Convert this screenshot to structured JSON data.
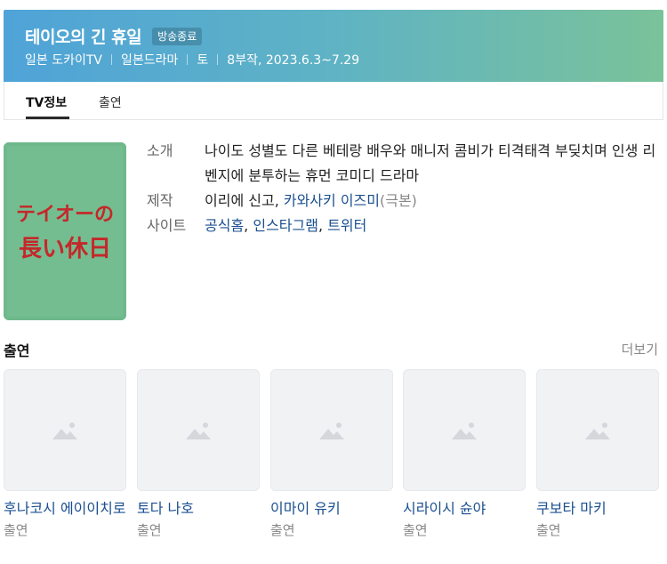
{
  "header": {
    "title": "테이오의 긴 휴일",
    "badge": "방송종료",
    "meta": [
      "일본 도카이TV",
      "일본드라마",
      "토",
      "8부작, 2023.6.3~7.29"
    ],
    "gradient_colors": [
      "#4fa3d8",
      "#7ac29a"
    ]
  },
  "tabs": [
    {
      "label": "TV정보",
      "active": true
    },
    {
      "label": "출연",
      "active": false
    }
  ],
  "poster": {
    "icon": "poster-image",
    "title_lines": [
      "テイオーの",
      "長い休日"
    ],
    "bg_color": "#6fb88c",
    "text_color": "#c4282a"
  },
  "info": {
    "intro_label": "소개",
    "intro_text": "나이도 성별도 다른 베테랑 배우와 매니저 콤비가 티격태격 부딪치며 인생 리벤지에 분투하는 휴먼 코미디 드라마",
    "production_label": "제작",
    "production_people": [
      "이리에 신고",
      "카와사키 이즈미"
    ],
    "production_role": "(극본)",
    "site_label": "사이트",
    "sites": [
      "공식홈",
      "인스타그램",
      "트위터"
    ]
  },
  "cast": {
    "title": "출연",
    "more_label": "더보기",
    "members": [
      {
        "name": "후나코시 에이이치로",
        "role": "출연"
      },
      {
        "name": "토다 나호",
        "role": "출연"
      },
      {
        "name": "이마이 유키",
        "role": "출연"
      },
      {
        "name": "시라이시 슌야",
        "role": "출연"
      },
      {
        "name": "쿠보타 마키",
        "role": "출연"
      }
    ]
  },
  "colors": {
    "link": "#1a4f8f",
    "muted": "#888888",
    "placeholder_bg": "#f1f2f4"
  }
}
